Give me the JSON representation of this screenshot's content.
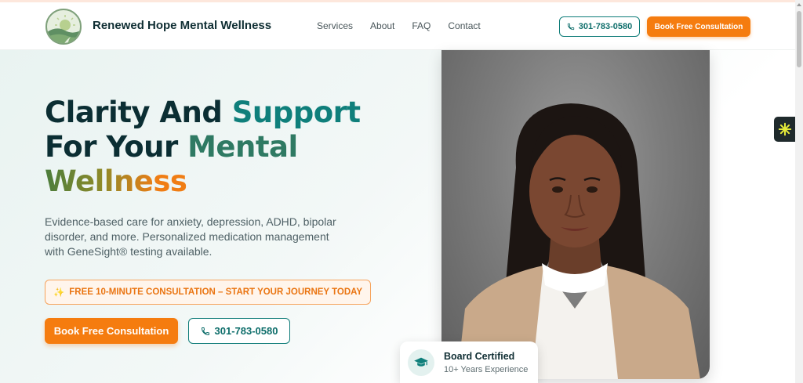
{
  "header": {
    "brand": "Renewed Hope Mental Wellness",
    "nav": [
      "Services",
      "About",
      "FAQ",
      "Contact"
    ],
    "phone": "301-783-0580",
    "cta": "Book Free Consultation"
  },
  "hero": {
    "headline": {
      "part1": "Clarity And ",
      "part2": "Support",
      "part3": "For Your ",
      "part4": "Mental",
      "part5": "Wellness"
    },
    "description": "Evidence-based care for anxiety, depression, ADHD, bipolar disorder, and more. Personalized medication management with GeneSight® testing available.",
    "banner_icon": "✨",
    "banner": "FREE 10-MINUTE CONSULTATION – START YOUR JOURNEY TODAY",
    "primary_button": "Book Free Consultation",
    "phone_button": "301-783-0580"
  },
  "badge": {
    "title": "Board Certified",
    "subtitle": "10+ Years Experience",
    "icon": "graduation-cap-icon"
  },
  "colors": {
    "teal": "#0f7f7b",
    "orange": "#f57c0f",
    "dark": "#0b2e33"
  }
}
